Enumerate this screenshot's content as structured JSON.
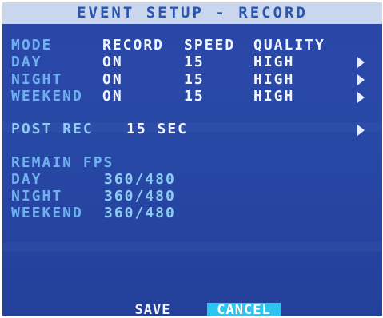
{
  "title": "EVENT SETUP - RECORD",
  "schedule_headers": {
    "mode": "MODE",
    "record": "RECORD",
    "speed": "SPEED",
    "quality": "QUALITY"
  },
  "schedule_rows": [
    {
      "mode": "DAY",
      "record": "ON",
      "speed": "15",
      "quality": "HIGH"
    },
    {
      "mode": "NIGHT",
      "record": "ON",
      "speed": "15",
      "quality": "HIGH"
    },
    {
      "mode": "WEEKEND",
      "record": "ON",
      "speed": "15",
      "quality": "HIGH"
    }
  ],
  "post_rec": {
    "label": "POST REC",
    "value": "15 SEC"
  },
  "remain_fps": {
    "heading": "REMAIN FPS",
    "rows": [
      {
        "label": "DAY",
        "value": "360/480"
      },
      {
        "label": "NIGHT",
        "value": "360/480"
      },
      {
        "label": "WEEKEND",
        "value": "360/480"
      }
    ]
  },
  "buttons": {
    "save": "SAVE",
    "cancel": "CANCEL"
  },
  "icons": {
    "row_arrow": "right-arrow-icon"
  },
  "colors": {
    "background": "#2848a6",
    "title_bar": "#c9d6ee",
    "label": "#6fb0ef",
    "value": "#f2f5ff",
    "cancel_highlight": "#2fc3ef"
  }
}
